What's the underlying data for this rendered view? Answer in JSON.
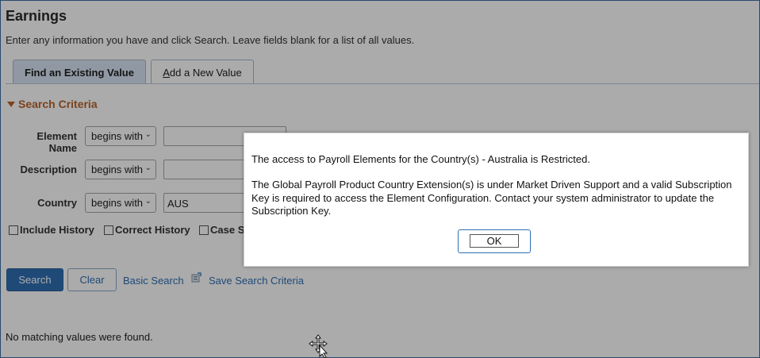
{
  "page": {
    "title": "Earnings",
    "instructions": "Enter any information you have and click Search. Leave fields blank for a list of all values."
  },
  "tabs": [
    {
      "label": "Find an Existing Value",
      "active": true
    },
    {
      "label": "Add a New Value",
      "access_key": "A",
      "label_rest": "dd a New Value",
      "active": false
    }
  ],
  "search_criteria": {
    "heading": "Search Criteria",
    "fields": [
      {
        "label": "Element Name",
        "operator": "begins with",
        "value": ""
      },
      {
        "label": "Description",
        "operator": "begins with",
        "value": ""
      },
      {
        "label": "Country",
        "operator": "begins with",
        "value": "AUS"
      }
    ],
    "checkboxes": [
      {
        "label": "Include History",
        "checked": false
      },
      {
        "label": "Correct History",
        "checked": false
      },
      {
        "label": "Case S",
        "checked": false
      }
    ]
  },
  "actions": {
    "search": "Search",
    "clear": "Clear",
    "basic_search": "Basic Search",
    "save_search_criteria": "Save Search Criteria"
  },
  "results": {
    "message": "No matching values were found."
  },
  "modal": {
    "message_1": "The access to Payroll Elements for the Country(s) - Australia  is Restricted.",
    "message_2": "The Global Payroll Product Country Extension(s) is under Market Driven Support and a valid Subscription Key is required to access the Element Configuration. Contact your system administrator to update the Subscription Key.",
    "ok": "OK"
  },
  "colors": {
    "accent": "#2f6fb3",
    "section_heading": "#b9632a",
    "active_tab": "#d7e5f3"
  }
}
